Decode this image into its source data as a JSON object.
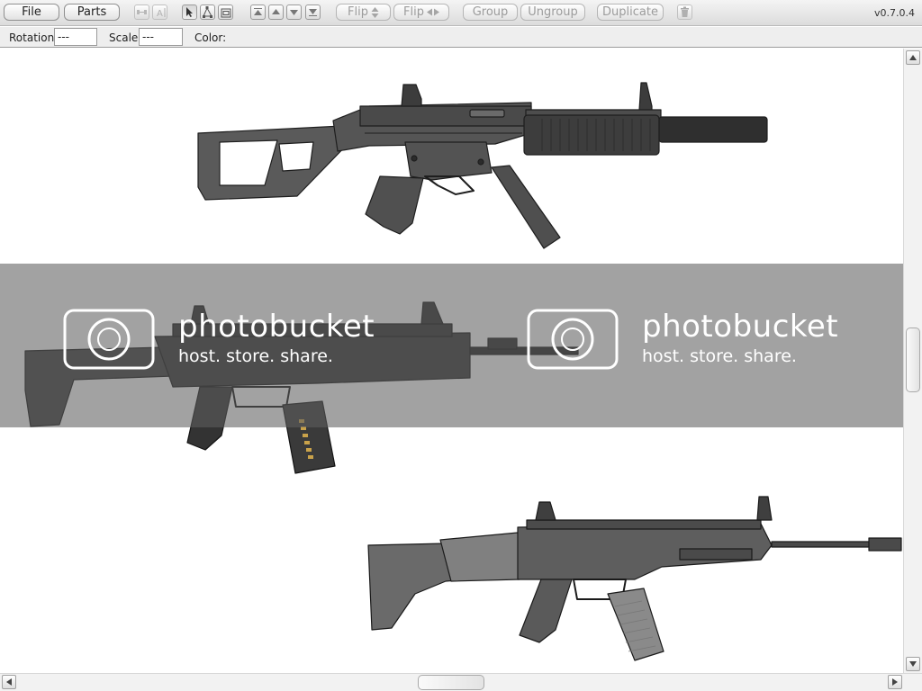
{
  "toolbar": {
    "file_label": "File",
    "parts_label": "Parts",
    "flip_v_label": "Flip",
    "flip_h_label": "Flip",
    "group_label": "Group",
    "ungroup_label": "Ungroup",
    "duplicate_label": "Duplicate",
    "version": "v0.7.0.4",
    "tool_icons": [
      "distribute-icon",
      "text-align-icon",
      "pointer-tool-icon",
      "edit-tool-icon",
      "box-tool-icon",
      "bring-to-front-icon",
      "move-up-icon",
      "move-down-icon",
      "send-to-back-icon",
      "trash-icon"
    ]
  },
  "properties": {
    "rotation_label": "Rotation:",
    "rotation_value": "---",
    "scale_label": "Scale:",
    "scale_value": "---",
    "color_label": "Color:"
  },
  "canvas": {
    "parts": [
      "submachine-gun-with-suppressor",
      "modular-rifle",
      "battle-rifle"
    ],
    "gun_color": "#5a5a5a",
    "watermark": {
      "brand": "photobucket",
      "tagline": "host. store. share.",
      "color": "#5f5f5f"
    }
  }
}
